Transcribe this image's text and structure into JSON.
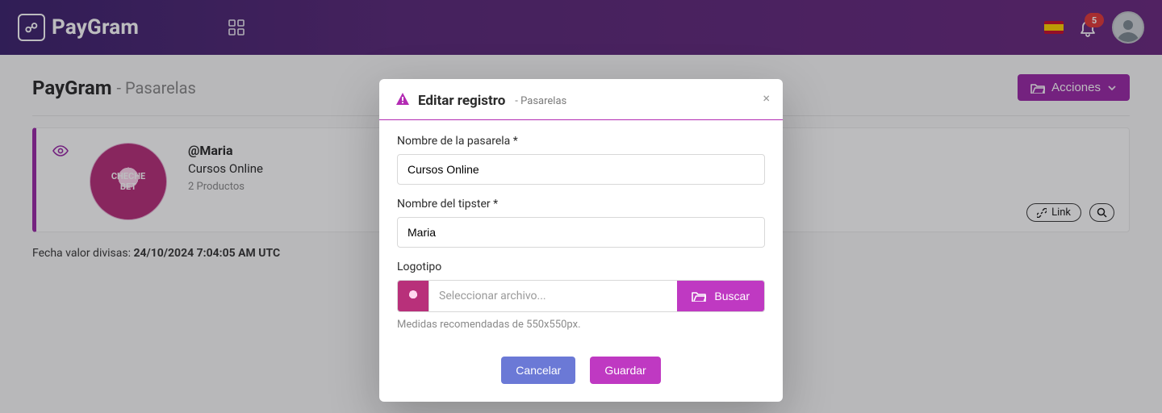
{
  "brand": {
    "name": "PayGram"
  },
  "topbar": {
    "notifications_count": "5"
  },
  "page": {
    "title": "PayGram",
    "section": "Pasarelas",
    "actions_label": "Acciones"
  },
  "gateway_card": {
    "handle": "@Maria",
    "title": "Cursos Online",
    "products": "2 Productos",
    "link_label": "Link"
  },
  "fx": {
    "prefix": "Fecha valor divisas:",
    "value": "24/10/2024 7:04:05 AM UTC"
  },
  "modal": {
    "title": "Editar registro",
    "subtitle": "Pasarelas",
    "close": "×",
    "fields": {
      "name_label": "Nombre de la pasarela *",
      "name_value": "Cursos Online",
      "tipster_label": "Nombre del tipster *",
      "tipster_value": "Maria",
      "logo_label": "Logotipo",
      "logo_placeholder": "Seleccionar archivo...",
      "logo_button": "Buscar",
      "logo_hint": "Medidas recomendadas de 550x550px."
    },
    "buttons": {
      "cancel": "Cancelar",
      "save": "Guardar"
    }
  }
}
